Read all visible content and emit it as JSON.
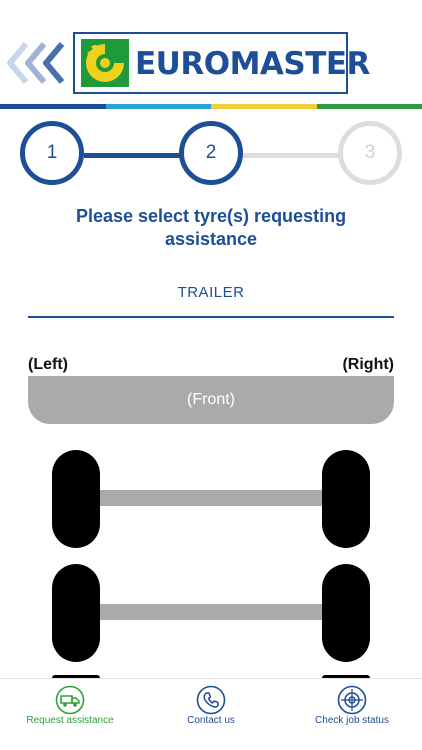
{
  "header": {
    "logo_text": "EUROMASTER",
    "back_icon": "triple-chevron-left-icon",
    "logo_icon": "euromaster-wheel-logo-icon"
  },
  "colors": {
    "brand_blue": "#1d4e96",
    "brand_green": "#2fa038",
    "stripe": [
      "#1d4e96",
      "#2aa2d6",
      "#f2cf3a",
      "#2f9b45"
    ],
    "inactive": "#dddddd",
    "axle_gray": "#aaaaaa"
  },
  "stepper": {
    "steps": [
      "1",
      "2",
      "3"
    ],
    "current_step": 2
  },
  "title": "Please select tyre(s) requesting assistance",
  "tab": "TRAILER",
  "diagram": {
    "left_label": "(Left)",
    "right_label": "(Right)",
    "front_label": "(Front)",
    "axles": 2
  },
  "bottom_nav": {
    "items": [
      {
        "label": "Request assistance",
        "icon": "tow-truck-icon",
        "active": true
      },
      {
        "label": "Contact us",
        "icon": "phone-icon",
        "active": false
      },
      {
        "label": "Check job status",
        "icon": "job-status-icon",
        "active": false
      }
    ]
  }
}
